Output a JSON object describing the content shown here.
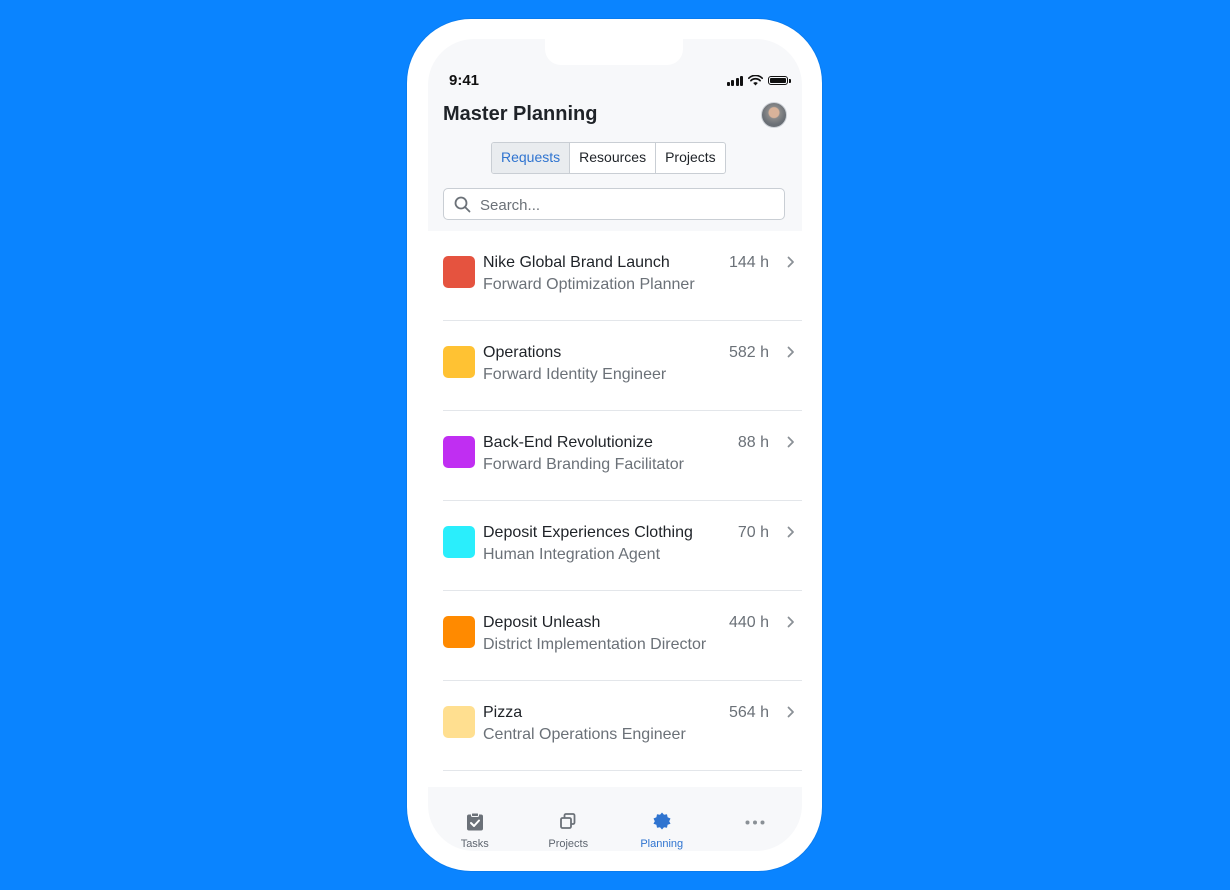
{
  "status_bar": {
    "time": "9:41"
  },
  "header": {
    "title": "Master Planning"
  },
  "segments": [
    {
      "label": "Requests",
      "active": true
    },
    {
      "label": "Resources",
      "active": false
    },
    {
      "label": "Projects",
      "active": false
    }
  ],
  "search": {
    "placeholder": "Search..."
  },
  "requests": [
    {
      "title": "Nike Global Brand Launch",
      "subtitle": "Forward Optimization Planner",
      "hours": "144 h",
      "color": "#e5533f"
    },
    {
      "title": "Operations",
      "subtitle": "Forward Identity Engineer",
      "hours": "582 h",
      "color": "#ffc233"
    },
    {
      "title": "Back-End Revolutionize",
      "subtitle": "Forward Branding Facilitator",
      "hours": "88 h",
      "color": "#c02ef2"
    },
    {
      "title": "Deposit Experiences Clothing",
      "subtitle": "Human Integration Agent",
      "hours": "70 h",
      "color": "#2aeefc"
    },
    {
      "title": "Deposit Unleash",
      "subtitle": "District Implementation Director",
      "hours": "440 h",
      "color": "#ff8a00"
    },
    {
      "title": "Pizza",
      "subtitle": "Central Operations Engineer",
      "hours": "564 h",
      "color": "#ffdf90"
    }
  ],
  "tabbar": [
    {
      "label": "Tasks",
      "icon": "clipboard-check-icon",
      "active": false
    },
    {
      "label": "Projects",
      "icon": "stacked-squares-icon",
      "active": false
    },
    {
      "label": "Planning",
      "icon": "badge-gear-icon",
      "active": true
    },
    {
      "label": "",
      "icon": "more-dots-icon",
      "active": false
    }
  ],
  "colors": {
    "background": "#0a84ff",
    "accent": "#2f74d0"
  }
}
